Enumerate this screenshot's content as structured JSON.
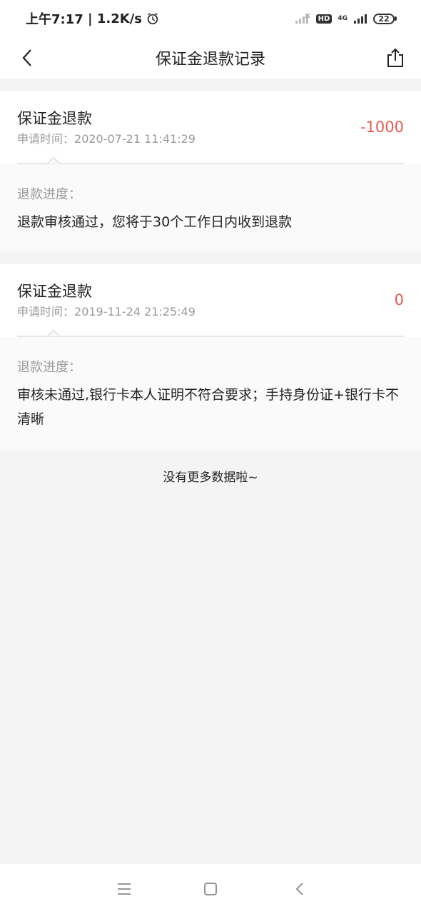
{
  "status_bar": {
    "time": "上午7:17",
    "speed": "1.2K/s",
    "hd": "HD",
    "network": "4G",
    "battery": "22",
    "icons": [
      "alarm-icon",
      "signal-icon",
      "wifi-icon"
    ]
  },
  "header": {
    "title": "保证金退款记录",
    "back_icon": "chevron-left-icon",
    "share_icon": "share-icon"
  },
  "records": [
    {
      "type": "保证金退款",
      "time_label": "申请时间：",
      "time": "2020-07-21 11:41:29",
      "amount": "-1000",
      "progress_label": "退款进度：",
      "progress_text": "退款审核通过，您将于30个工作日内收到退款"
    },
    {
      "type": "保证金退款",
      "time_label": "申请时间：",
      "time": "2019-11-24 21:25:49",
      "amount": "0",
      "progress_label": "退款进度：",
      "progress_text": "审核未通过,银行卡本人证明不符合要求；手持身份证+银行卡不清晰"
    }
  ],
  "footer_text": "没有更多数据啦~",
  "colors": {
    "amount": "#e85a4f",
    "muted": "#9a9a9a",
    "background": "#f4f4f4"
  },
  "system_nav": [
    "menu-icon",
    "home-icon",
    "back-icon"
  ]
}
